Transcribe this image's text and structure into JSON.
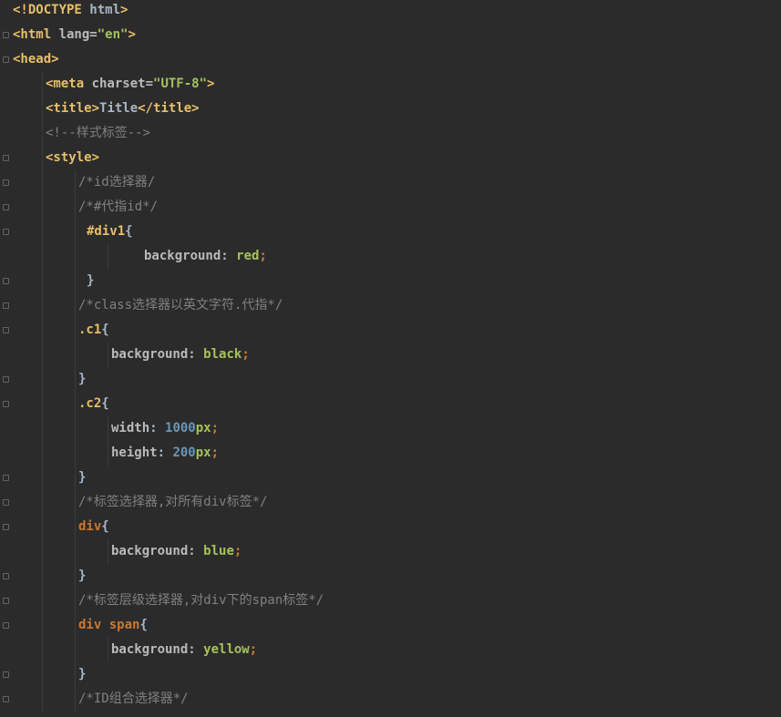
{
  "editor": {
    "lines": [
      {
        "indent": 0,
        "tokens": [
          {
            "t": "<!DOCTYPE ",
            "c": "tag"
          },
          {
            "t": "html",
            "c": "plain"
          },
          {
            "t": ">",
            "c": "tag"
          }
        ]
      },
      {
        "indent": 0,
        "tokens": [
          {
            "t": "<html ",
            "c": "tag"
          },
          {
            "t": "lang=",
            "c": "attr"
          },
          {
            "t": "\"en\"",
            "c": "str"
          },
          {
            "t": ">",
            "c": "tag"
          }
        ]
      },
      {
        "indent": 0,
        "tokens": [
          {
            "t": "<head>",
            "c": "tag"
          }
        ]
      },
      {
        "indent": 36,
        "tokens": [
          {
            "t": "<meta ",
            "c": "tag"
          },
          {
            "t": "charset=",
            "c": "attr"
          },
          {
            "t": "\"UTF-8\"",
            "c": "str"
          },
          {
            "t": ">",
            "c": "tag"
          }
        ]
      },
      {
        "indent": 36,
        "tokens": [
          {
            "t": "<title>",
            "c": "tag"
          },
          {
            "t": "Title",
            "c": "plain"
          },
          {
            "t": "</title>",
            "c": "tag"
          }
        ]
      },
      {
        "indent": 36,
        "tokens": [
          {
            "t": "<!--样式标签-->",
            "c": "cmt"
          }
        ]
      },
      {
        "indent": 36,
        "tokens": [
          {
            "t": "<style>",
            "c": "tag"
          }
        ]
      },
      {
        "indent": 72,
        "tokens": [
          {
            "t": "/*id选择器/",
            "c": "cmt"
          }
        ]
      },
      {
        "indent": 72,
        "tokens": [
          {
            "t": "/*#代指id*/",
            "c": "cmt"
          }
        ]
      },
      {
        "indent": 81,
        "tokens": [
          {
            "t": "#div1",
            "c": "sel"
          },
          {
            "t": "{",
            "c": "plain"
          }
        ]
      },
      {
        "indent": 144,
        "tokens": [
          {
            "t": "background",
            "c": "prop"
          },
          {
            "t": ": ",
            "c": "plain"
          },
          {
            "t": "red",
            "c": "val"
          },
          {
            "t": ";",
            "c": "punc"
          }
        ]
      },
      {
        "indent": 81,
        "tokens": [
          {
            "t": "}",
            "c": "plain"
          }
        ]
      },
      {
        "indent": 72,
        "tokens": [
          {
            "t": "/*class选择器以英文字符.代指*/",
            "c": "cmt"
          }
        ]
      },
      {
        "indent": 72,
        "tokens": [
          {
            "t": ".c1",
            "c": "sel"
          },
          {
            "t": "{",
            "c": "plain"
          }
        ]
      },
      {
        "indent": 108,
        "tokens": [
          {
            "t": "background",
            "c": "prop"
          },
          {
            "t": ": ",
            "c": "plain"
          },
          {
            "t": "black",
            "c": "val"
          },
          {
            "t": ";",
            "c": "punc"
          }
        ]
      },
      {
        "indent": 72,
        "tokens": [
          {
            "t": "}",
            "c": "plain"
          }
        ]
      },
      {
        "indent": 72,
        "tokens": [
          {
            "t": ".c2",
            "c": "sel"
          },
          {
            "t": "{",
            "c": "plain"
          }
        ]
      },
      {
        "indent": 108,
        "tokens": [
          {
            "t": "width",
            "c": "prop"
          },
          {
            "t": ": ",
            "c": "plain"
          },
          {
            "t": "1000",
            "c": "num"
          },
          {
            "t": "px",
            "c": "val"
          },
          {
            "t": ";",
            "c": "punc"
          }
        ]
      },
      {
        "indent": 108,
        "tokens": [
          {
            "t": "height",
            "c": "prop"
          },
          {
            "t": ": ",
            "c": "plain"
          },
          {
            "t": "200",
            "c": "num"
          },
          {
            "t": "px",
            "c": "val"
          },
          {
            "t": ";",
            "c": "punc"
          }
        ]
      },
      {
        "indent": 72,
        "tokens": [
          {
            "t": "}",
            "c": "plain"
          }
        ]
      },
      {
        "indent": 72,
        "tokens": [
          {
            "t": "/*标签选择器,对所有div标签*/",
            "c": "cmt"
          }
        ]
      },
      {
        "indent": 72,
        "tokens": [
          {
            "t": "div",
            "c": "kw"
          },
          {
            "t": "{",
            "c": "plain"
          }
        ]
      },
      {
        "indent": 108,
        "tokens": [
          {
            "t": "background",
            "c": "prop"
          },
          {
            "t": ": ",
            "c": "plain"
          },
          {
            "t": "blue",
            "c": "val"
          },
          {
            "t": ";",
            "c": "punc"
          }
        ]
      },
      {
        "indent": 72,
        "tokens": [
          {
            "t": "}",
            "c": "plain"
          }
        ]
      },
      {
        "indent": 72,
        "tokens": [
          {
            "t": "/*标签层级选择器,对div下的span标签*/",
            "c": "cmt"
          }
        ]
      },
      {
        "indent": 72,
        "tokens": [
          {
            "t": "div span",
            "c": "kw"
          },
          {
            "t": "{",
            "c": "plain"
          }
        ]
      },
      {
        "indent": 108,
        "tokens": [
          {
            "t": "background",
            "c": "prop"
          },
          {
            "t": ": ",
            "c": "plain"
          },
          {
            "t": "yellow",
            "c": "val"
          },
          {
            "t": ";",
            "c": "punc"
          }
        ]
      },
      {
        "indent": 72,
        "tokens": [
          {
            "t": "}",
            "c": "plain"
          }
        ]
      },
      {
        "indent": 72,
        "tokens": [
          {
            "t": "/*ID组合选择器*/",
            "c": "cmt"
          }
        ]
      }
    ],
    "folds": [
      1,
      2,
      6,
      7,
      8,
      9,
      11,
      12,
      13,
      15,
      16,
      19,
      20,
      21,
      23,
      24,
      25,
      27,
      28
    ],
    "colors": {
      "background": "#2b2b2b",
      "tag": "#e8bf6a",
      "comment": "#808080",
      "string": "#a5c25c",
      "number": "#6897bb",
      "keyword": "#cc7832",
      "text": "#a9b7c6"
    }
  }
}
